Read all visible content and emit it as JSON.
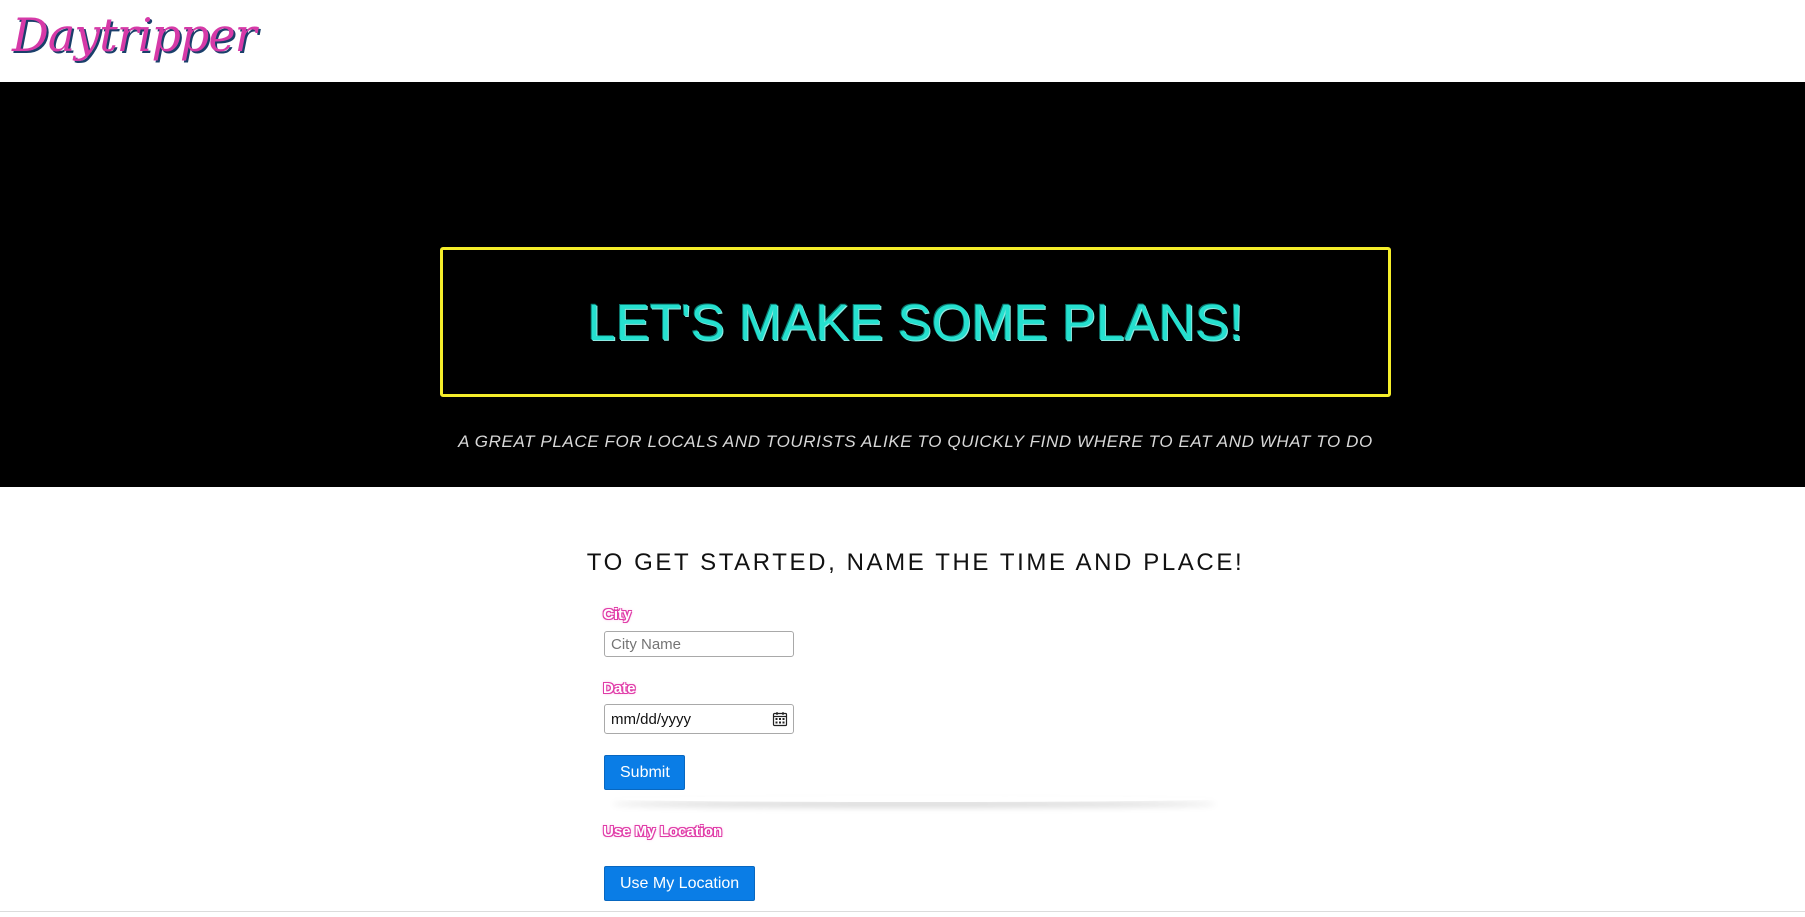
{
  "header": {
    "logo_text": "Daytripper"
  },
  "hero": {
    "title": "LET'S MAKE SOME PLANS!",
    "subtitle": "A GREAT PLACE FOR LOCALS AND TOURISTS ALIKE TO QUICKLY FIND WHERE TO EAT AND WHAT TO DO"
  },
  "form": {
    "heading": "TO GET STARTED, NAME THE TIME AND PLACE!",
    "city": {
      "label": "City",
      "value": "",
      "placeholder": "City Name"
    },
    "date": {
      "label": "Date",
      "placeholder": "mm/dd/yyyy",
      "icon": "calendar-icon"
    },
    "submit_label": "Submit",
    "location_label": "Use My Location",
    "location_button_label": "Use My Location"
  },
  "colors": {
    "logo": "#d63aa8",
    "hero_background": "#000000",
    "hero_border": "#f5ee2a",
    "hero_title": "#25e0cf",
    "label_pink": "#e03ca8",
    "button_blue": "#0a7de6"
  }
}
